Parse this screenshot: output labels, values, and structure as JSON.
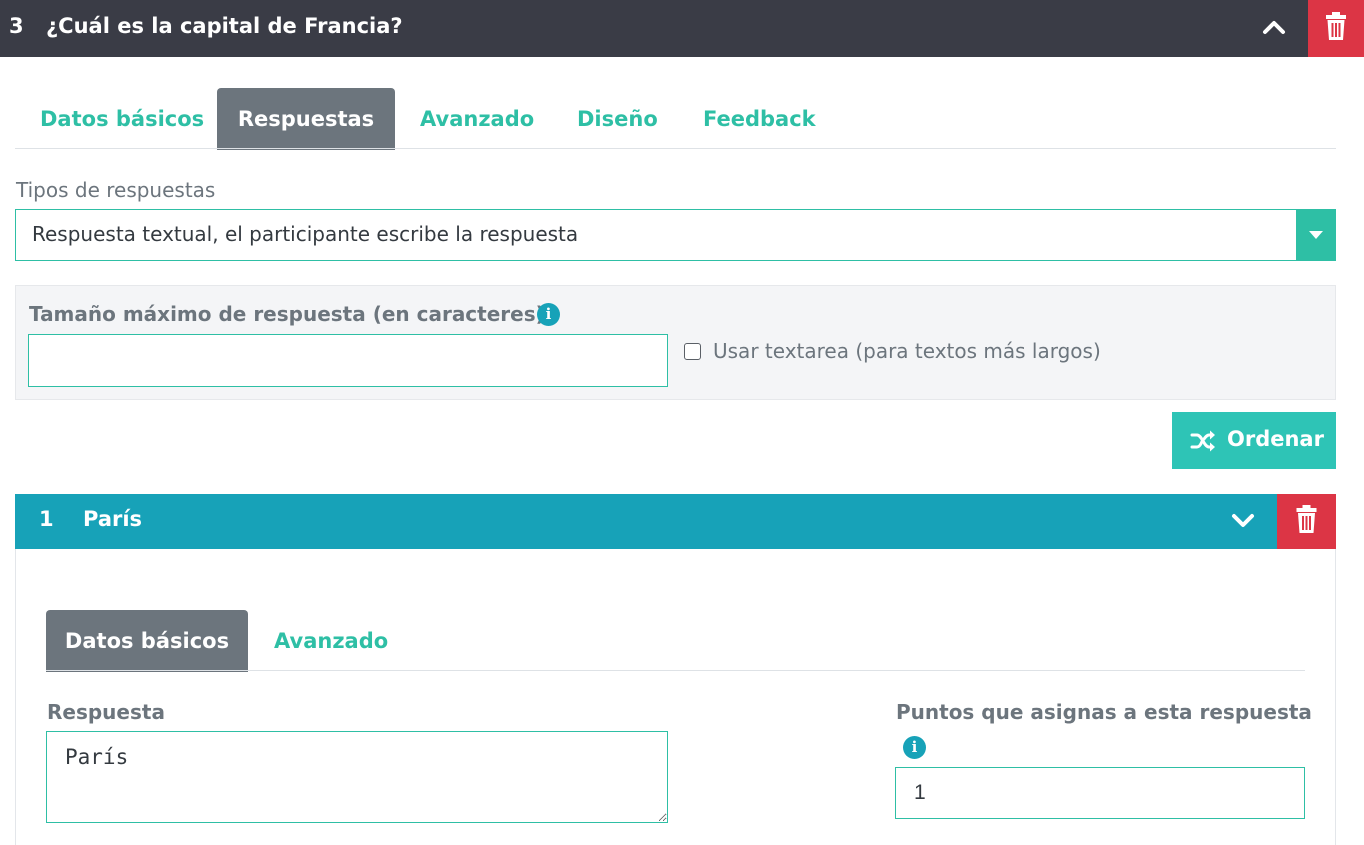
{
  "question": {
    "number": "3",
    "title": "¿Cuál es la capital de Francia?",
    "collapse_icon": "chevron-up-icon",
    "delete_icon": "trash-icon"
  },
  "tabs": [
    {
      "label": "Datos básicos"
    },
    {
      "label": "Respuestas",
      "active": true
    },
    {
      "label": "Avanzado"
    },
    {
      "label": "Diseño"
    },
    {
      "label": "Feedback"
    }
  ],
  "answer_type": {
    "label": "Tipos de respuestas",
    "selected": "Respuesta textual, el participante escribe la respuesta"
  },
  "max_size": {
    "label": "Tamaño máximo de respuesta (en caracteres)",
    "value": "",
    "info_icon": "info-icon"
  },
  "textarea_option": {
    "label": "Usar textarea (para textos más largos)",
    "checked": false
  },
  "order_button": {
    "label": "Ordenar",
    "icon": "shuffle-icon"
  },
  "answer": {
    "number": "1",
    "title": "París",
    "expand_icon": "chevron-down-icon",
    "delete_icon": "trash-icon",
    "tabs": [
      {
        "label": "Datos básicos",
        "active": true
      },
      {
        "label": "Avanzado"
      }
    ],
    "response_label": "Respuesta",
    "response_value": "París",
    "points_label": "Puntos que asignas a esta respuesta",
    "points_value": "1"
  },
  "colors": {
    "header_dark": "#3a3c46",
    "accent": "#2ebfa5",
    "answer_header": "#17a2b8",
    "danger": "#dc3545",
    "tab_active": "#6c757d"
  }
}
